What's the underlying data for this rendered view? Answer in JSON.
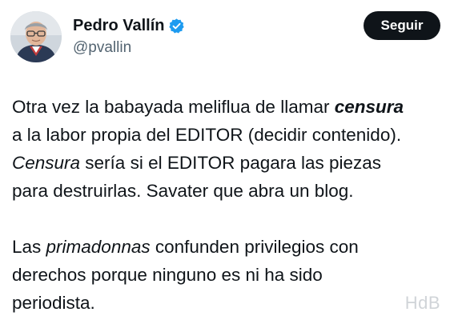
{
  "author": {
    "display_name": "Pedro Vallín",
    "handle": "@pvallin",
    "verified_icon": "verified-badge-icon",
    "verified_color": "#1d9bf0"
  },
  "follow_button": {
    "label": "Seguir"
  },
  "tweet": {
    "paragraph1": {
      "line1": {
        "pre": "Otra vez la babayada meliflua de llamar ",
        "emph": "censura"
      },
      "line2": "a la labor propia del EDITOR (decidir contenido).",
      "line3": {
        "emph": "Censura",
        "post": " sería si el EDITOR pagara las piezas"
      },
      "line4": "para destruirlas. Savater que abra un blog."
    },
    "paragraph2": {
      "line1": {
        "pre": "Las ",
        "emph": "primadonnas",
        "post": " confunden privilegios con"
      },
      "line2": "derechos porque ninguno es ni ha sido",
      "line3": "periodista."
    }
  },
  "watermark": "HdB"
}
